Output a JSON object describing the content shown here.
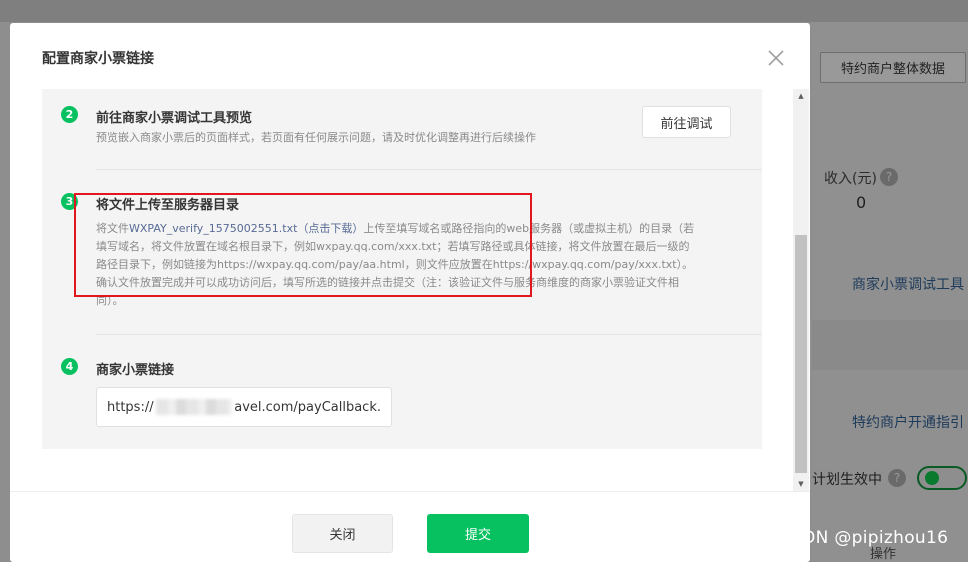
{
  "background": {
    "top_button": "特约商户整体数据",
    "income_label": "收入(元)",
    "income_value": "0",
    "link_receipt_tool": "商家小票调试工具",
    "link_onboarding": "特约商户开通指引",
    "plan_status": "计划生效中",
    "operation_label": "操作"
  },
  "modal": {
    "title": "配置商家小票链接",
    "steps": [
      {
        "number": "2",
        "title": "前往商家小票调试工具预览",
        "desc": "预览嵌入商家小票后的页面样式，若页面有任何展示问题，请及时优化调整再进行后续操作",
        "button": "前往调试"
      },
      {
        "number": "3",
        "title": "将文件上传至服务器目录",
        "desc_prefix": "将文件",
        "file_name": "WXPAY_verify_1575002551.txt",
        "download_link": "（点击下载）",
        "desc_line1_rest": "上传至填写域名或路径指向的web服务器（或虚拟主机）的目录（若",
        "desc_line2": "填写域名，将文件放置在域名根目录下，例如wxpay.qq.com/xxx.txt；若填写路径或具体链接，将文件放置在最后一级的",
        "desc_line3": "路径目录下，例如链接为https://wxpay.qq.com/pay/aa.html，则文件应放置在https://wxpay.qq.com/pay/xxx.txt）。",
        "desc_line4": "确认文件放置完成并可以成功访问后，填写所选的链接并点击提交（注：该验证文件与服务商维度的商家小票验证文件相",
        "desc_line5": "同）。"
      },
      {
        "number": "4",
        "title": "商家小票链接",
        "url_prefix": "https://",
        "url_suffix": "avel.com/payCallback."
      }
    ],
    "close_button": "关闭",
    "submit_button": "提交"
  },
  "watermark": "CSDN @pipizhou16"
}
